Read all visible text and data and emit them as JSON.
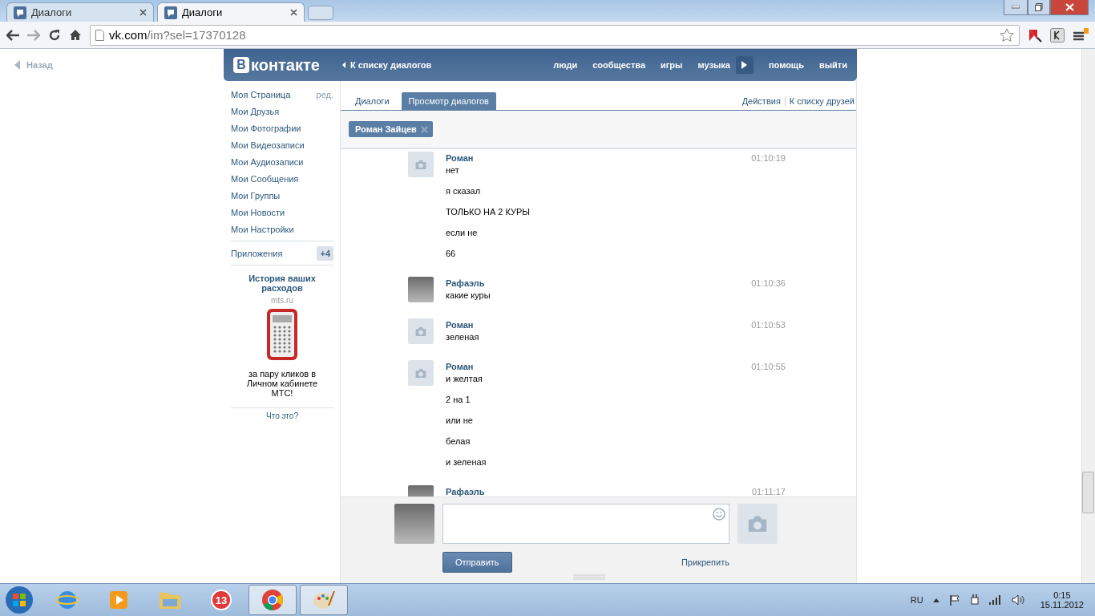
{
  "browser": {
    "tabs": [
      {
        "title": "Диалоги",
        "selected": false
      },
      {
        "title": "Диалоги",
        "selected": true
      }
    ],
    "url_host": "vk.com",
    "url_path": "/im?sel=17370128"
  },
  "back_link": "Назад",
  "header": {
    "logo_mark": "В",
    "logo_text": "контакте",
    "back_to_list": "К списку диалогов",
    "nav": [
      "люди",
      "сообщества",
      "игры",
      "музыка"
    ],
    "nav_right": [
      "помощь",
      "выйти"
    ]
  },
  "sidebar": {
    "items": [
      {
        "label": "Моя Страница",
        "action": "ред."
      },
      {
        "label": "Мои Друзья"
      },
      {
        "label": "Мои Фотографии"
      },
      {
        "label": "Мои Видеозаписи"
      },
      {
        "label": "Мои Аудиозаписи"
      },
      {
        "label": "Мои Сообщения"
      },
      {
        "label": "Мои Группы"
      },
      {
        "label": "Мои Новости"
      },
      {
        "label": "Мои Настройки"
      }
    ],
    "apps": {
      "label": "Приложения",
      "count": "+4"
    },
    "ad": {
      "title": "История ваших расходов",
      "domain": "mts.ru",
      "text": "за пару кликов в Личном кабинете МТС!",
      "footer": "Что это?"
    }
  },
  "dialog": {
    "tabs": [
      {
        "label": "Диалоги",
        "selected": false
      },
      {
        "label": "Просмотр диалогов",
        "selected": true
      }
    ],
    "actions": [
      "Действия",
      "К списку друзей"
    ],
    "peer": "Роман Зайцев",
    "messages": [
      {
        "author": "Роман",
        "kind": "camera",
        "time": "01:10:19",
        "lines": [
          "нет",
          "я сказал",
          "ТОЛЬКО НА 2 КУРЫ",
          "если не",
          "66"
        ]
      },
      {
        "author": "Рафаэль",
        "kind": "photo",
        "time": "01:10:36",
        "lines": [
          "какие куры"
        ]
      },
      {
        "author": "Роман",
        "kind": "camera",
        "time": "01:10:53",
        "lines": [
          "зеленая"
        ]
      },
      {
        "author": "Роман",
        "kind": "camera",
        "time": "01:10:55",
        "lines": [
          "и желтая",
          "2 на 1",
          "или не",
          "белая",
          "и зеленая"
        ]
      },
      {
        "author": "Рафаэль",
        "kind": "photo",
        "time": "01:11:17"
      }
    ],
    "composer": {
      "send": "Отправить",
      "attach": "Прикрепить"
    }
  },
  "taskbar": {
    "items": [
      {
        "kind": "ie",
        "selected": false
      },
      {
        "kind": "player",
        "selected": false
      },
      {
        "kind": "folder",
        "selected": false
      },
      {
        "kind": "badge",
        "label": "13",
        "selected": false
      },
      {
        "kind": "chrome",
        "selected": true
      },
      {
        "kind": "paint",
        "selected": true
      }
    ],
    "lang": "RU",
    "time": "0:15",
    "date": "15.11.2012"
  }
}
